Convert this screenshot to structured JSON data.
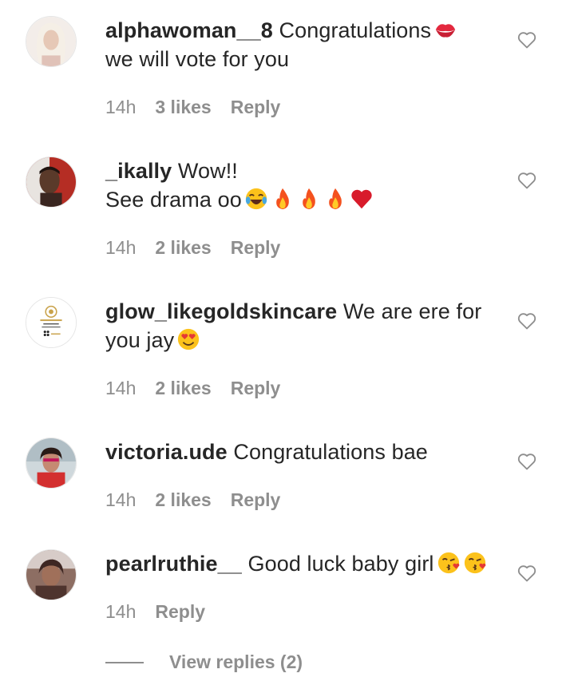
{
  "comments": [
    {
      "username": "alphawoman__8",
      "text": "Congratulations",
      "text2": "we will vote for you",
      "time": "14h",
      "likes": "3 likes",
      "reply": "Reply"
    },
    {
      "username": "_ikally",
      "text": "Wow!!",
      "text2": "See drama oo",
      "time": "14h",
      "likes": "2 likes",
      "reply": "Reply"
    },
    {
      "username": "glow_likegoldskincare",
      "text": "We are ere for",
      "text2": "you jay",
      "time": "14h",
      "likes": "2 likes",
      "reply": "Reply"
    },
    {
      "username": "victoria.ude",
      "text": "Congratulations bae",
      "time": "14h",
      "likes": "2 likes",
      "reply": "Reply"
    },
    {
      "username": "pearlruthie__",
      "text": "Good luck baby girl",
      "time": "14h",
      "reply": "Reply"
    }
  ],
  "view_replies": "View replies (2)",
  "colors": {
    "text": "#262626",
    "secondary": "#8e8e8e",
    "heart_outline": "#8e8e8e"
  },
  "icons": [
    "heart-outline-icon",
    "kiss-mark-emoji",
    "laughing-emoji",
    "fire-emoji",
    "red-heart-emoji",
    "heart-eyes-emoji",
    "kissing-face-emoji"
  ]
}
